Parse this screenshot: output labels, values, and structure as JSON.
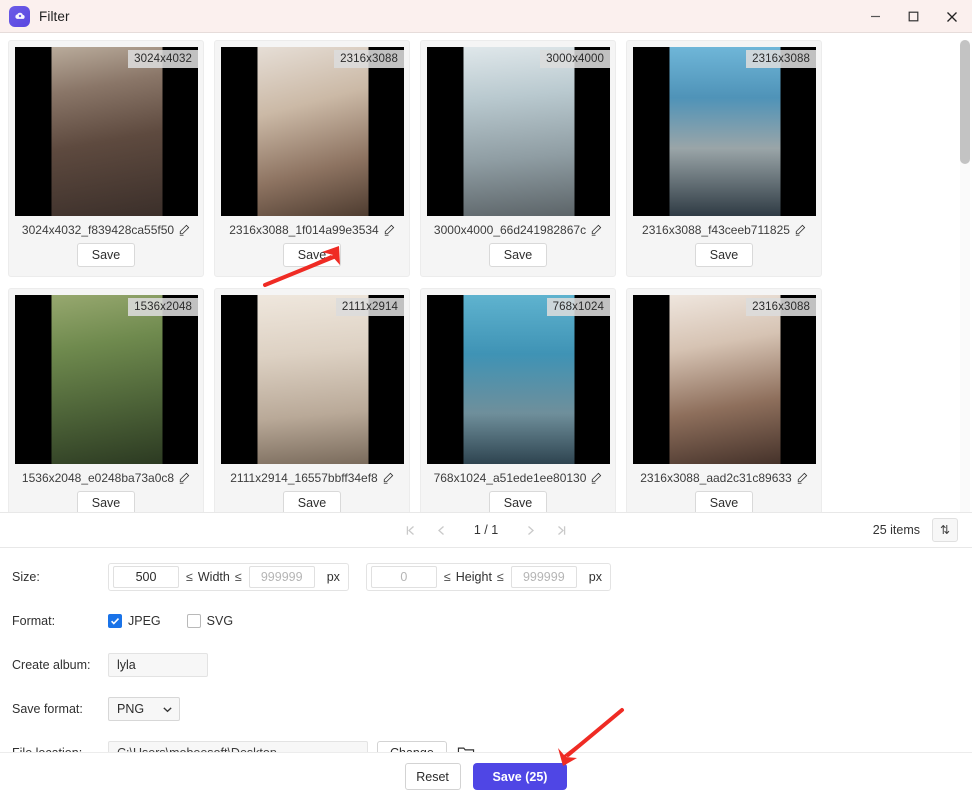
{
  "titlebar": {
    "app_title": "Filter",
    "logo_icon": "cloud-logo-icon",
    "minimize_icon": "minimize-icon",
    "maximize_icon": "maximize-icon",
    "close_icon": "close-icon"
  },
  "grid": {
    "cards": [
      {
        "dimensions": "3024x4032",
        "name": "3024x4032_f839428ca55f50",
        "save_label": "Save",
        "photo_class": "p1"
      },
      {
        "dimensions": "2316x3088",
        "name": "2316x3088_1f014a99e3534",
        "save_label": "Save",
        "photo_class": "p2"
      },
      {
        "dimensions": "3000x4000",
        "name": "3000x4000_66d241982867c",
        "save_label": "Save",
        "photo_class": "p3"
      },
      {
        "dimensions": "2316x3088",
        "name": "2316x3088_f43ceeb711825",
        "save_label": "Save",
        "photo_class": "p4"
      },
      {
        "dimensions": "1536x2048",
        "name": "1536x2048_e0248ba73a0c8",
        "save_label": "Save",
        "photo_class": "p5"
      },
      {
        "dimensions": "2111x2914",
        "name": "2111x2914_16557bbff34ef8",
        "save_label": "Save",
        "photo_class": "p6"
      },
      {
        "dimensions": "768x1024",
        "name": "768x1024_a51ede1ee80130",
        "save_label": "Save",
        "photo_class": "p7"
      },
      {
        "dimensions": "2316x3088",
        "name": "2316x3088_aad2c31c89633",
        "save_label": "Save",
        "photo_class": "p8"
      }
    ]
  },
  "pager": {
    "first_icon": "first-page-icon",
    "prev_icon": "prev-page-icon",
    "page_text": "1 / 1",
    "next_icon": "next-page-icon",
    "last_icon": "last-page-icon",
    "items_count": "25 items",
    "sort_icon": "sort-updown-icon",
    "sort_glyph": "⇅"
  },
  "filters": {
    "size": {
      "label": "Size:",
      "width_min_value": "500",
      "width_max_placeholder": "999999",
      "width_label": "Width",
      "height_min_placeholder": "0",
      "height_max_placeholder": "999999",
      "height_label": "Height",
      "cmp_left": "≤",
      "cmp_right": "≤",
      "unit": "px"
    },
    "format": {
      "label": "Format:",
      "options": [
        {
          "label": "JPEG",
          "checked": true
        },
        {
          "label": "SVG",
          "checked": false
        }
      ]
    },
    "create_album": {
      "label": "Create album:",
      "value": "lyla"
    },
    "save_format": {
      "label": "Save format:",
      "value": "PNG",
      "chevron_icon": "chevron-down-icon"
    },
    "file_location": {
      "label": "File location:",
      "value": "C:\\Users\\mobeesoft\\Desktop",
      "change_label": "Change",
      "folder_icon": "folder-open-icon"
    }
  },
  "footer": {
    "reset_label": "Reset",
    "save_label": "Save (25)",
    "primary_color": "#4f46e5"
  },
  "annotations": {
    "arrow_color": "#ef2b24",
    "arrow_1": "points-to-card-2-save-button",
    "arrow_2": "points-to-footer-save-button"
  }
}
